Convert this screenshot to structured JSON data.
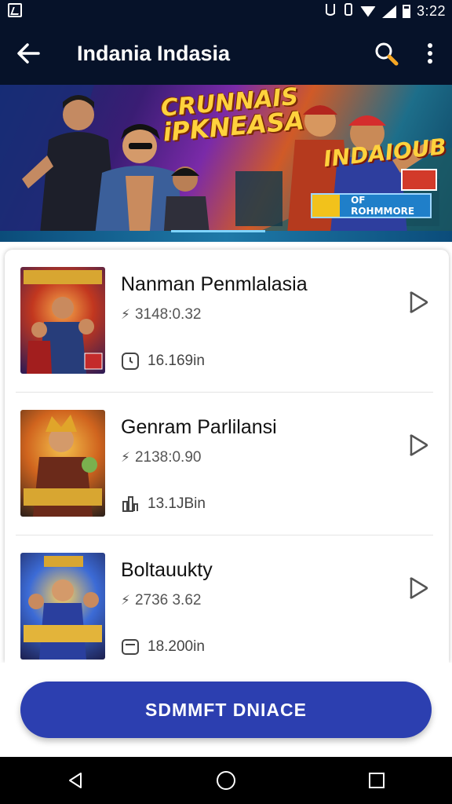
{
  "status_bar": {
    "time": "3:22",
    "icons": [
      "screenshot-icon",
      "alarm-icon",
      "vibrate-icon",
      "wifi-icon",
      "signal-icon",
      "battery-icon"
    ]
  },
  "app_bar": {
    "title": "Indania Indasia",
    "back_icon": "arrow-left-icon",
    "search_icon": "search-icon",
    "menu_icon": "more-vertical-icon"
  },
  "banner": {
    "title_line1": "CRUNNAIS",
    "title_line2": "iPKNEASA",
    "tagline": "INDAIOUB",
    "badge": "OF ROHMMORE"
  },
  "items": [
    {
      "title": "Nanman Penmlalasia",
      "meta": "3148:0.32",
      "size": "16.169in",
      "meta_icon": "bolt-icon",
      "size_icon": "clock-icon",
      "action_icon": "play-icon"
    },
    {
      "title": "Genram Parlilansi",
      "meta": "2138:0.90",
      "size": "13.1JBin",
      "meta_icon": "bolt-icon",
      "size_icon": "chart-icon",
      "action_icon": "play-icon"
    },
    {
      "title": "Boltauukty",
      "meta": "2736 3.62",
      "size": "18.200in",
      "meta_icon": "bolt-icon",
      "size_icon": "message-icon",
      "action_icon": "play-icon"
    }
  ],
  "primary_button": {
    "label": "SDMMFT DNIACE"
  },
  "nav_bar": {
    "icons": [
      "nav-back-icon",
      "nav-home-icon",
      "nav-recents-icon"
    ]
  },
  "colors": {
    "app_bar": "#061229",
    "button": "#2c3fb0"
  }
}
